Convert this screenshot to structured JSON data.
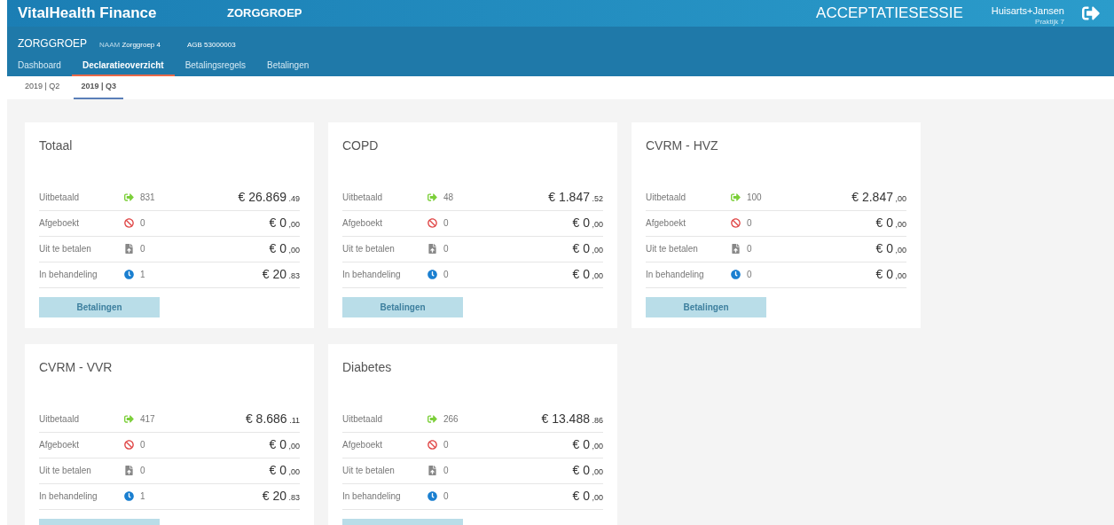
{
  "header": {
    "brand": "VitalHealth Finance",
    "section": "ZORGGROEP",
    "session": "ACCEPTATIESESSIE",
    "user": "Huisarts+Jansen",
    "practice": "Praktijk 7"
  },
  "org": {
    "title": "ZORGGROEP",
    "name_label": "NAAM",
    "name": "Zorggroep 4",
    "agb_label": "AGB",
    "agb": "53000003"
  },
  "nav": [
    {
      "label": "Dashboard",
      "selected": false
    },
    {
      "label": "Declaratieoverzicht",
      "selected": true
    },
    {
      "label": "Betalingsregels",
      "selected": false
    },
    {
      "label": "Betalingen",
      "selected": false
    }
  ],
  "periods": [
    {
      "label": "2019 | Q2",
      "selected": false
    },
    {
      "label": "2019 | Q3",
      "selected": true
    }
  ],
  "cards": [
    {
      "title": "Totaal",
      "button": "Betalingen",
      "rows": [
        {
          "kind": "paid",
          "label": "Uitbetaald",
          "count": "831",
          "amount": "€ 26.869",
          "cents": ".49"
        },
        {
          "kind": "written_off",
          "label": "Afgeboekt",
          "count": "0",
          "amount": "€ 0",
          "cents": ",00"
        },
        {
          "kind": "to_pay",
          "label": "Uit te betalen",
          "count": "0",
          "amount": "€ 0",
          "cents": ",00"
        },
        {
          "kind": "pending",
          "label": "In behandeling",
          "count": "1",
          "amount": "€ 20",
          "cents": ".83"
        }
      ]
    },
    {
      "title": "COPD",
      "button": "Betalingen",
      "rows": [
        {
          "kind": "paid",
          "label": "Uitbetaald",
          "count": "48",
          "amount": "€ 1.847",
          "cents": ".52"
        },
        {
          "kind": "written_off",
          "label": "Afgeboekt",
          "count": "0",
          "amount": "€ 0",
          "cents": ",00"
        },
        {
          "kind": "to_pay",
          "label": "Uit te betalen",
          "count": "0",
          "amount": "€ 0",
          "cents": ",00"
        },
        {
          "kind": "pending",
          "label": "In behandeling",
          "count": "0",
          "amount": "€ 0",
          "cents": ",00"
        }
      ]
    },
    {
      "title": "CVRM - HVZ",
      "button": "Betalingen",
      "rows": [
        {
          "kind": "paid",
          "label": "Uitbetaald",
          "count": "100",
          "amount": "€ 2.847",
          "cents": ",00"
        },
        {
          "kind": "written_off",
          "label": "Afgeboekt",
          "count": "0",
          "amount": "€ 0",
          "cents": ",00"
        },
        {
          "kind": "to_pay",
          "label": "Uit te betalen",
          "count": "0",
          "amount": "€ 0",
          "cents": ",00"
        },
        {
          "kind": "pending",
          "label": "In behandeling",
          "count": "0",
          "amount": "€ 0",
          "cents": ",00"
        }
      ]
    },
    {
      "title": "CVRM - VVR",
      "button_partial": true,
      "rows": [
        {
          "kind": "paid",
          "label": "Uitbetaald",
          "count": "417",
          "amount": "€ 8.686",
          "cents": ".11"
        },
        {
          "kind": "written_off",
          "label": "Afgeboekt",
          "count": "0",
          "amount": "€ 0",
          "cents": ",00"
        },
        {
          "kind": "to_pay",
          "label": "Uit te betalen",
          "count": "0",
          "amount": "€ 0",
          "cents": ",00"
        },
        {
          "kind": "pending",
          "label": "In behandeling",
          "count": "1",
          "amount": "€ 20",
          "cents": ".83"
        }
      ]
    },
    {
      "title": "Diabetes",
      "button_partial": true,
      "rows": [
        {
          "kind": "paid",
          "label": "Uitbetaald",
          "count": "266",
          "amount": "€ 13.488",
          "cents": ".86"
        },
        {
          "kind": "written_off",
          "label": "Afgeboekt",
          "count": "0",
          "amount": "€ 0",
          "cents": ",00"
        },
        {
          "kind": "to_pay",
          "label": "Uit te betalen",
          "count": "0",
          "amount": "€ 0",
          "cents": ",00"
        },
        {
          "kind": "pending",
          "label": "In behandeling",
          "count": "0",
          "amount": "€ 0",
          "cents": ",00"
        }
      ]
    }
  ]
}
